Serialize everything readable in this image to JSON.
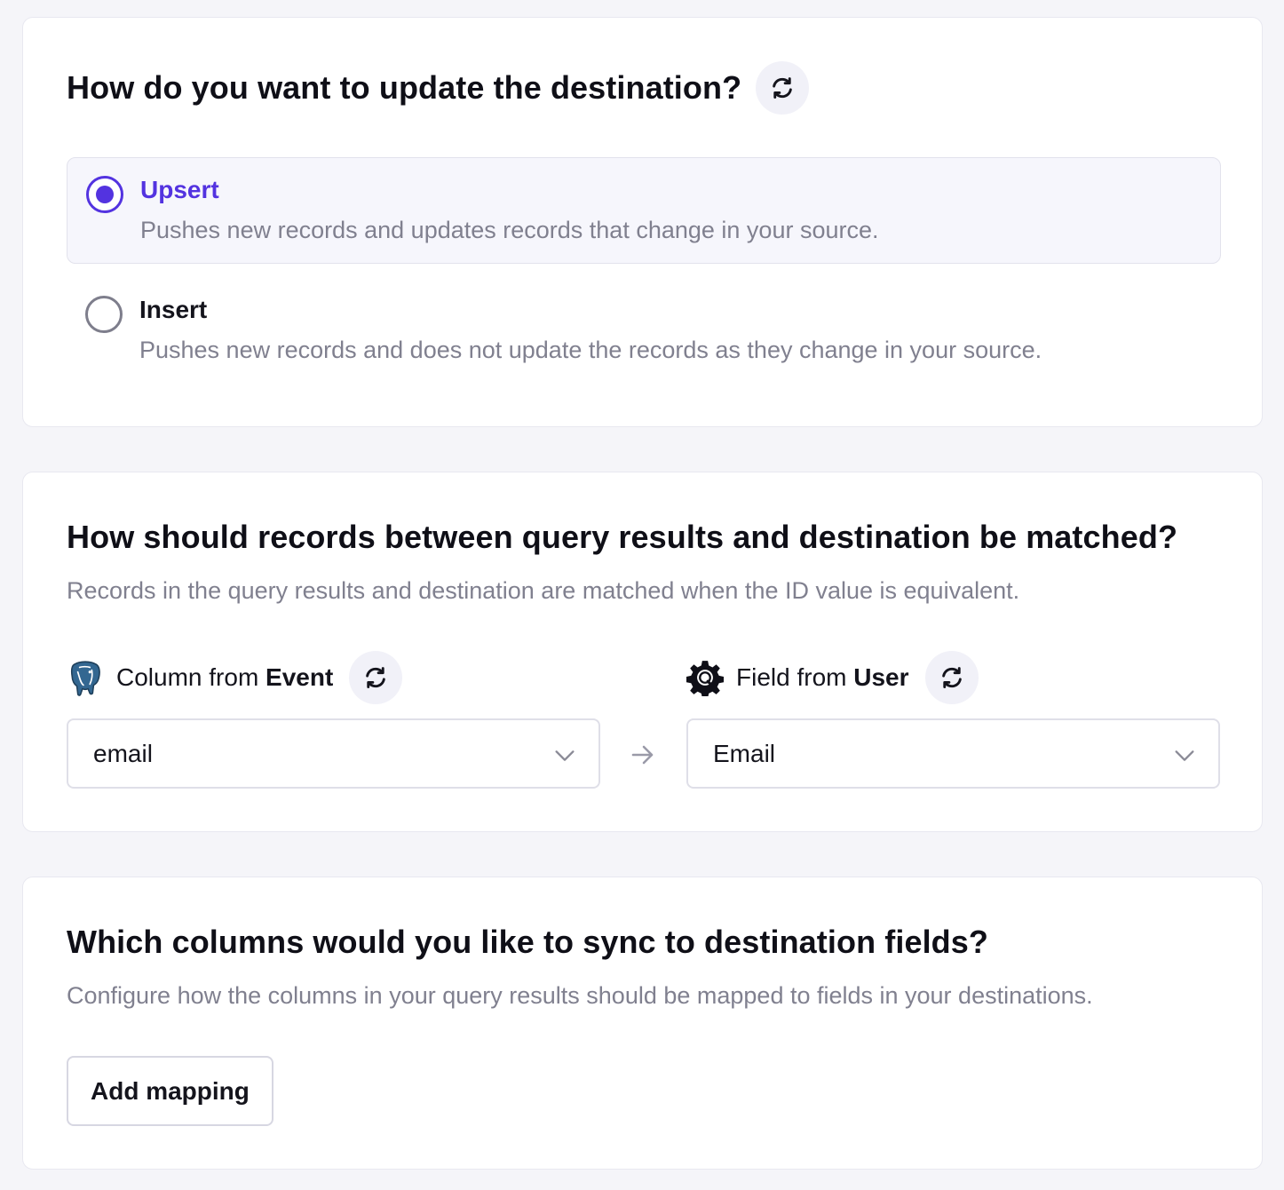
{
  "update_mode": {
    "title": "How do you want to update the destination?",
    "refresh_icon": "refresh-icon",
    "options": [
      {
        "label": "Upsert",
        "description": "Pushes new records and updates records that change in your source.",
        "selected": true
      },
      {
        "label": "Insert",
        "description": "Pushes new records and does not update the records as they change in your source.",
        "selected": false
      }
    ]
  },
  "matching": {
    "title": "How should records between query results and destination be matched?",
    "description": "Records in the query results and destination are matched when the ID value is equivalent.",
    "source": {
      "icon": "postgresql-icon",
      "label_prefix": "Column from",
      "label_bold": "Event",
      "selected_value": "email"
    },
    "destination": {
      "icon": "gear-icon",
      "label_prefix": "Field from",
      "label_bold": "User",
      "selected_value": "Email"
    }
  },
  "mapping": {
    "title": "Which columns would you like to sync to destination fields?",
    "description": "Configure how the columns in your query results should be mapped to fields in your destinations.",
    "add_button_label": "Add mapping"
  },
  "colors": {
    "accent": "#5333e0",
    "page_background": "#f5f5f9",
    "muted_text": "#80808f",
    "refresh_button_bg": "#f1f1f8"
  }
}
